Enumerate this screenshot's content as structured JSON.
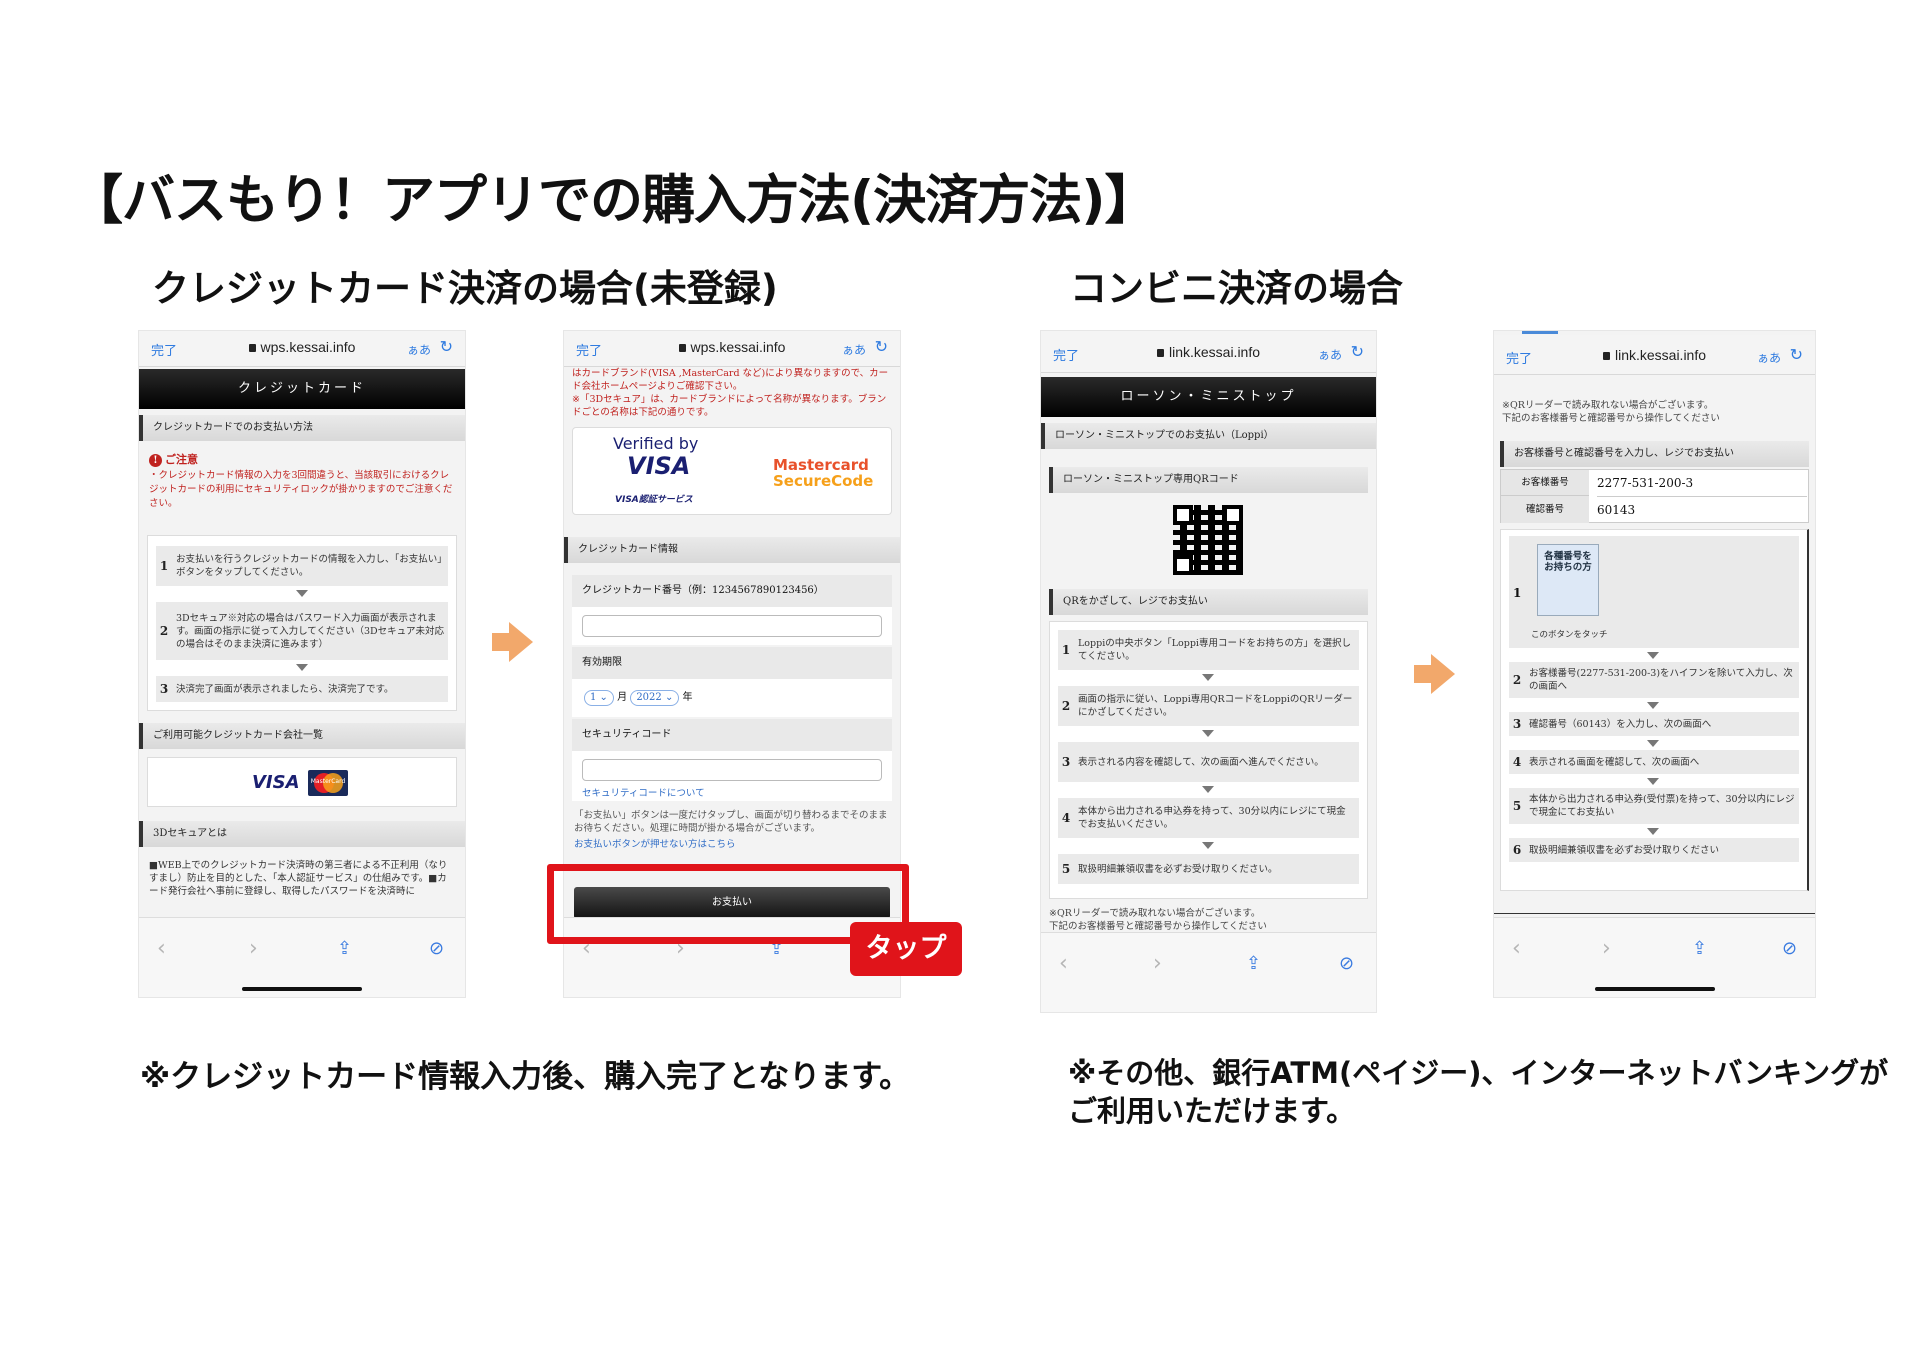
{
  "page": {
    "title": "【バスもり！アプリでの購入方法(決済方法)】",
    "credit_section_title": "クレジットカード決済の場合(未登録)",
    "convenience_section_title": "コンビニ決済の場合",
    "credit_note": "※クレジットカード情報入力後、購入完了となります。",
    "convenience_note_line1": "※その他、銀行ATM(ペイジー)、インターネットバンキングが",
    "convenience_note_line2": "ご利用いただけます。",
    "accent_color": "#f2a86b",
    "highlight_color": "#e0141a"
  },
  "browser": {
    "done_label": "完了",
    "text_size_label": "ぁあ",
    "reload_icon": "reload-icon",
    "lock_icon": "lock-icon"
  },
  "screen1": {
    "url": "wps.kessai.info",
    "banner": "クレジットカード",
    "section_pay_method": "クレジットカードでのお支払い方法",
    "caution_title": "ご注意",
    "caution_text": "・クレジットカード情報の入力を3回間違うと、当該取引におけるクレジットカードの利用にセキュリティロックが掛かりますのでご注意ください。",
    "steps": [
      {
        "num": "1",
        "text": "お支払いを行うクレジットカードの情報を入力し、「お支払い」ボタンをタップしてください。"
      },
      {
        "num": "2",
        "text": "3Dセキュア※対応の場合はパスワード入力画面が表示されます。画面の指示に従って入力してください（3Dセキュア未対応の場合はそのまま決済に進みます）"
      },
      {
        "num": "3",
        "text": "決済完了画面が表示されましたら、決済完了です。"
      }
    ],
    "section_cards": "ご利用可能クレジットカード会社一覧",
    "visa_logo": "VISA",
    "mastercard_logo": "MasterCard",
    "section_3d": "3Dセキュアとは",
    "three_d_text": "■WEB上でのクレジットカード決済時の第三者による不正利用（なりすまし）防止を目的とした、「本人認証サービス」の仕組みです。■カード発行会社へ事前に登録し、取得したパスワードを決済時に"
  },
  "screen2": {
    "url": "wps.kessai.info",
    "top_text": "はカードブランド(VISA ,MasterCard など)により異なりますので、カード会社ホームページよりご確認下さい。",
    "top_note": "※「3Dセキュア」は、カードブランドによって名称が異なります。ブランドごとの名称は下記の通りです。",
    "verified_by": "Verified by",
    "visa": "VISA",
    "visa_service": "VISA認証サービス",
    "mastercard": "Mastercard",
    "securecode": "SecureCode",
    "section_card_info": "クレジットカード情報",
    "card_number_label": "クレジットカード番号（例：1234567890123456）",
    "card_number_value": "",
    "expiry_label": "有効期限",
    "expiry_month": "1",
    "month_unit": "月",
    "expiry_year": "2022",
    "year_unit": "年",
    "security_code_label": "セキュリティコード",
    "security_code_value": "",
    "security_code_link": "セキュリティコードについて",
    "pay_note": "「お支払い」ボタンは一度だけタップし、画面が切り替わるまでそのままお待ちください。処理に時間が掛かる場合がございます。",
    "pay_note_link": "お支払いボタンが押せない方はこちら",
    "pay_button": "お支払い",
    "tap_label": "タップ"
  },
  "screen3": {
    "url": "link.kessai.info",
    "banner": "ローソン・ミニストップ",
    "section_pay": "ローソン・ミニストップでのお支払い（Loppi）",
    "section_qr": "ローソン・ミニストップ専用QRコード",
    "section_scan": "QRをかざして、レジでお支払い",
    "steps": [
      {
        "num": "1",
        "text": "Loppiの中央ボタン「Loppi専用コードをお持ちの方」を選択してください。"
      },
      {
        "num": "2",
        "text": "画面の指示に従い、Loppi専用QRコードをLoppiのQRリーダーにかざしてください。"
      },
      {
        "num": "3",
        "text": "表示される内容を確認して、次の画面へ進んでください。"
      },
      {
        "num": "4",
        "text": "本体から出力される申込券を持って、30分以内にレジにて現金でお支払いください。"
      },
      {
        "num": "5",
        "text": "取扱明細兼領収書を必ずお受け取りください。"
      }
    ],
    "footer_note_1": "※QRリーダーで読み取れない場合がございます。",
    "footer_note_2": "下記のお客様番号と確認番号から操作してください"
  },
  "screen4": {
    "url": "link.kessai.info",
    "top_note_1": "※QRリーダーで読み取れない場合がございます。",
    "top_note_2": "下記のお客様番号と確認番号から操作してください",
    "section": "お客様番号と確認番号を入力し、レジでお支払い",
    "customer_number_label": "お客様番号",
    "customer_number": "2277-531-200-3",
    "confirm_number_label": "確認番号",
    "confirm_number": "60143",
    "button_image_title": "各種番号をお持ちの方",
    "button_image_caption": "このボタンをタッチ",
    "steps": [
      {
        "num": "2",
        "text": "お客様番号(2277-531-200-3)をハイフンを除いて入力し、次の画面へ"
      },
      {
        "num": "3",
        "text": "確認番号（60143）を入力し、次の画面へ"
      },
      {
        "num": "4",
        "text": "表示される画面を確認して、次の画面へ"
      },
      {
        "num": "5",
        "text": "本体から出力される申込券(受付票)を持って、30分以内にレジで現金にてお支払い"
      },
      {
        "num": "6",
        "text": "取扱明細兼領収書を必ずお受け取りください"
      }
    ]
  }
}
